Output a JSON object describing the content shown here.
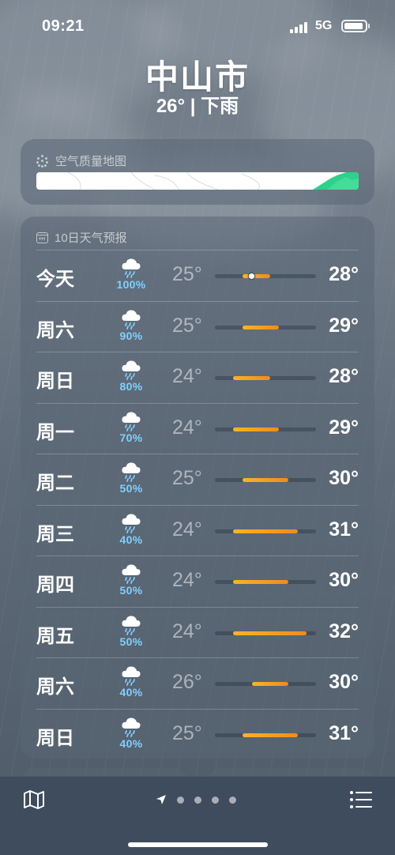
{
  "status_bar": {
    "time": "09:21",
    "network": "5G",
    "battery_icon": "battery-full-icon",
    "signal_icon": "cellular-signal-icon"
  },
  "header": {
    "city": "中山市",
    "condition": "26° | 下雨"
  },
  "air_quality": {
    "title": "空气质量地图",
    "icon": "air-quality-dots-icon",
    "accent": "#2fd18a"
  },
  "forecast": {
    "title": "10日天气预报",
    "icon": "calendar-icon",
    "range": {
      "min": 22,
      "max": 33
    },
    "current_temp": 26,
    "days": [
      {
        "name": "今天",
        "icon": "cloud-rain-icon",
        "pop": "100%",
        "low_label": "25°",
        "high_label": "28°",
        "low": 25,
        "high": 28,
        "today": true
      },
      {
        "name": "周六",
        "icon": "cloud-rain-icon",
        "pop": "90%",
        "low_label": "25°",
        "high_label": "29°",
        "low": 25,
        "high": 29
      },
      {
        "name": "周日",
        "icon": "cloud-rain-icon",
        "pop": "80%",
        "low_label": "24°",
        "high_label": "28°",
        "low": 24,
        "high": 28
      },
      {
        "name": "周一",
        "icon": "cloud-rain-icon",
        "pop": "70%",
        "low_label": "24°",
        "high_label": "29°",
        "low": 24,
        "high": 29
      },
      {
        "name": "周二",
        "icon": "cloud-rain-icon",
        "pop": "50%",
        "low_label": "25°",
        "high_label": "30°",
        "low": 25,
        "high": 30
      },
      {
        "name": "周三",
        "icon": "cloud-rain-icon",
        "pop": "40%",
        "low_label": "24°",
        "high_label": "31°",
        "low": 24,
        "high": 31
      },
      {
        "name": "周四",
        "icon": "cloud-rain-icon",
        "pop": "50%",
        "low_label": "24°",
        "high_label": "30°",
        "low": 24,
        "high": 30
      },
      {
        "name": "周五",
        "icon": "cloud-rain-icon",
        "pop": "50%",
        "low_label": "24°",
        "high_label": "32°",
        "low": 24,
        "high": 32
      },
      {
        "name": "周六",
        "icon": "cloud-rain-icon",
        "pop": "40%",
        "low_label": "26°",
        "high_label": "30°",
        "low": 26,
        "high": 30
      },
      {
        "name": "周日",
        "icon": "cloud-rain-icon",
        "pop": "40%",
        "low_label": "25°",
        "high_label": "31°",
        "low": 25,
        "high": 31
      }
    ]
  },
  "toolbar": {
    "map_icon": "map-icon",
    "list_icon": "list-icon",
    "location_icon": "location-arrow-icon",
    "page_count": 5,
    "current_page": 0
  }
}
